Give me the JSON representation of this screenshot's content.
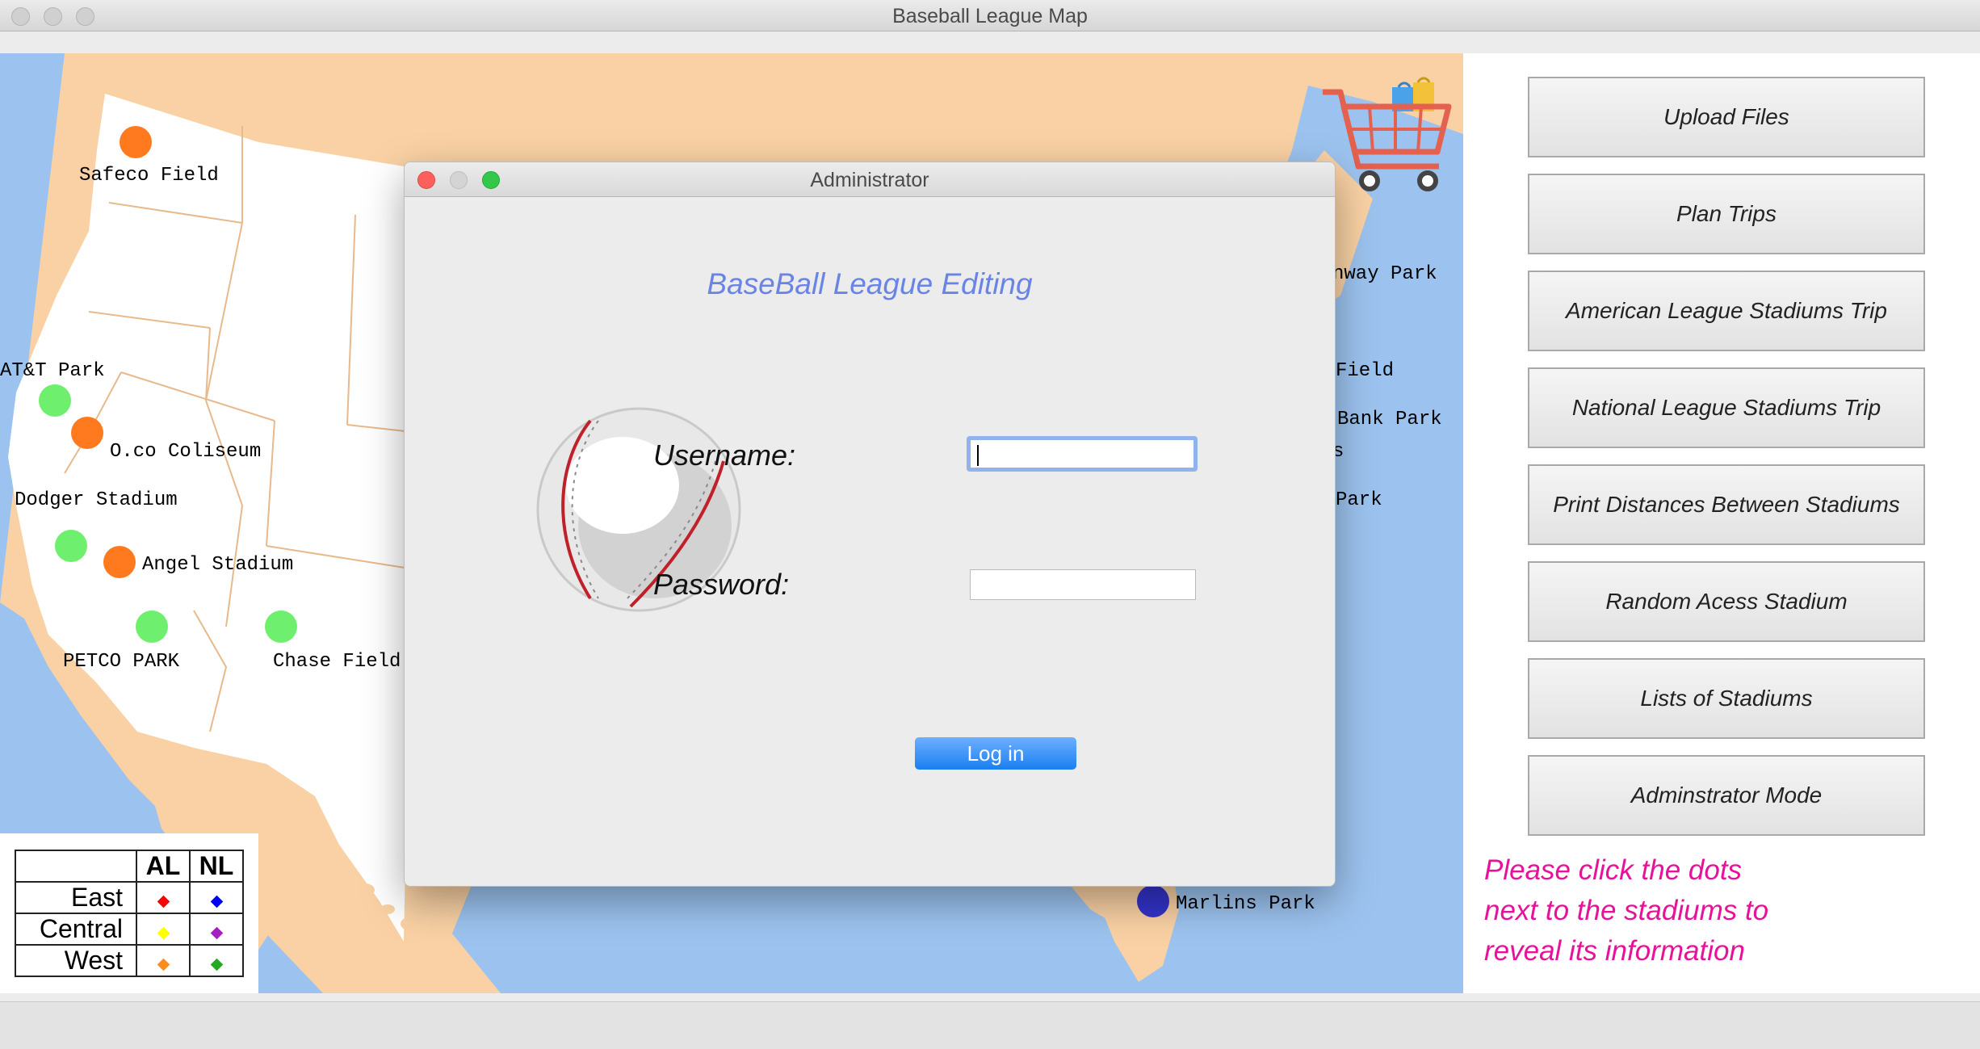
{
  "window": {
    "title": "Baseball League Map"
  },
  "map": {
    "stadiums": [
      {
        "name": "Safeco Field",
        "dot_color": "#ff7a1f"
      },
      {
        "name": "AT&T Park",
        "dot_color": "#6ef06e"
      },
      {
        "name": "O.co Coliseum",
        "dot_color": "#ff7a1f"
      },
      {
        "name": "Dodger Stadium",
        "dot_color": "#6ef06e"
      },
      {
        "name": "Angel Stadium",
        "dot_color": "#ff7a1f"
      },
      {
        "name": "PETCO PARK",
        "dot_color": "#6ef06e"
      },
      {
        "name": "Chase Field",
        "dot_color": "#6ef06e"
      },
      {
        "name": "Marlins Park",
        "dot_color": "#3333cc"
      }
    ],
    "partial_labels": [
      "nway Park",
      "Field",
      "Bank Park",
      "s",
      "Park"
    ],
    "colors": {
      "ocean": "#9cc3ef",
      "land": "#f9d1a4",
      "us_states": "#ffffff",
      "state_lines": "#e8b98b"
    }
  },
  "legend": {
    "columns": [
      "AL",
      "NL"
    ],
    "rows": [
      {
        "label": "East",
        "al_color": "#ff0000",
        "nl_color": "#0000ff"
      },
      {
        "label": "Central",
        "al_color": "#ffff00",
        "nl_color": "#a020c0"
      },
      {
        "label": "West",
        "al_color": "#ff8c1a",
        "nl_color": "#22aa22"
      }
    ]
  },
  "cart_icon": "shopping-cart-icon",
  "sidebar": {
    "buttons": [
      "Upload Files",
      "Plan Trips",
      "American League Stadiums Trip",
      "National League Stadiums Trip",
      "Print Distances Between Stadiums",
      "Random Acess Stadium",
      "Lists of Stadiums",
      "Adminstrator Mode"
    ],
    "hint_lines": [
      "Please click the dots",
      "next to the stadiums to",
      "reveal its information"
    ]
  },
  "dialog": {
    "title": "Administrator",
    "heading": "BaseBall League Editing",
    "username_label": "Username:",
    "username_value": "",
    "password_label": "Password:",
    "password_value": "",
    "login_label": "Log in",
    "icon": "baseball-icon"
  }
}
